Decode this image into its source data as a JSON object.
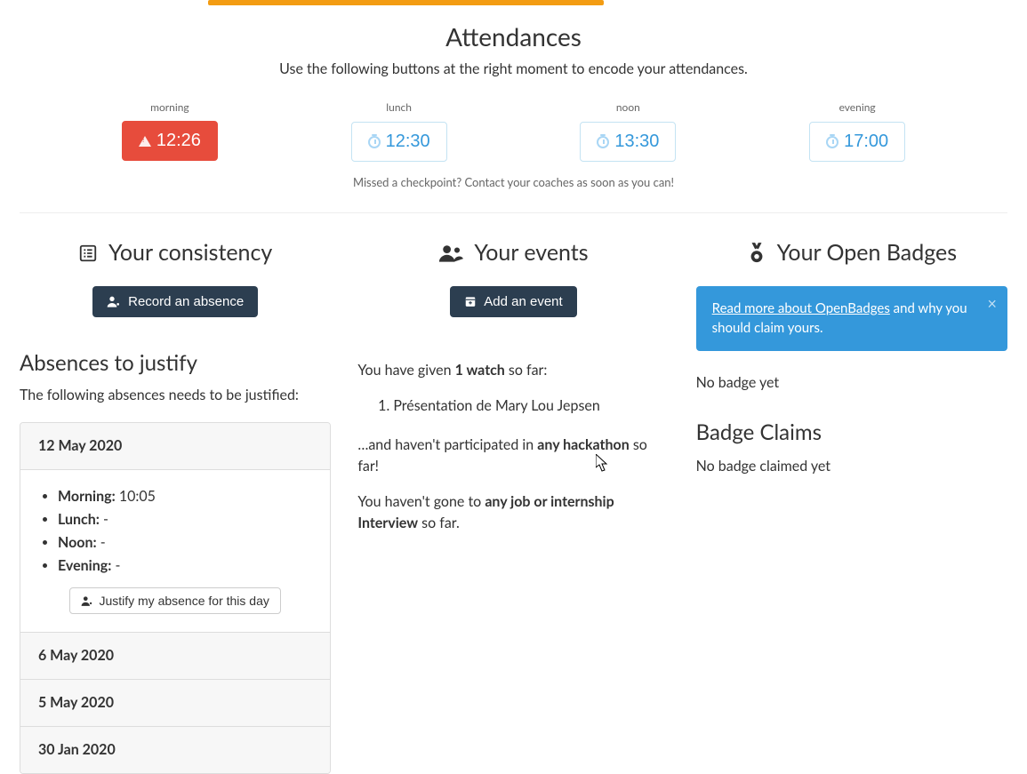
{
  "header": {
    "title": "Attendances",
    "subtitle": "Use the following buttons at the right moment to encode your attendances.",
    "missed_note": "Missed a checkpoint? Contact your coaches as soon as you can!"
  },
  "checkpoints": [
    {
      "label": "morning",
      "time": "12:26",
      "variant": "red",
      "icon": "warning-triangle-icon"
    },
    {
      "label": "lunch",
      "time": "12:30",
      "variant": "blue-outline",
      "icon": "stopwatch-icon"
    },
    {
      "label": "noon",
      "time": "13:30",
      "variant": "blue-outline",
      "icon": "stopwatch-icon"
    },
    {
      "label": "evening",
      "time": "17:00",
      "variant": "blue-outline",
      "icon": "stopwatch-icon"
    }
  ],
  "consistency": {
    "title": "Your consistency",
    "record_button": "Record an absence",
    "justify_title": "Absences to justify",
    "justify_desc": "The following absences needs to be justified:",
    "expanded": {
      "date": "12 May 2020",
      "rows": [
        {
          "label": "Morning:",
          "value": "10:05"
        },
        {
          "label": "Lunch:",
          "value": "-"
        },
        {
          "label": "Noon:",
          "value": "-"
        },
        {
          "label": "Evening:",
          "value": "-"
        }
      ],
      "justify_button": "Justify my absence for this day"
    },
    "collapsed": [
      "6 May 2020",
      "5 May 2020",
      "30 Jan 2020"
    ]
  },
  "events": {
    "title": "Your events",
    "add_button": "Add an event",
    "given_prefix": "You have given ",
    "given_bold": "1 watch",
    "given_suffix": " so far:",
    "watch_list": [
      "Présentation de Mary Lou Jepsen"
    ],
    "hack_prefix": "…and haven't participated in ",
    "hack_bold": "any hackathon",
    "hack_suffix": " so far!",
    "interview_prefix": "You haven't gone to ",
    "interview_bold": "any job or internship Interview",
    "interview_suffix": " so far."
  },
  "badges": {
    "title": "Your Open Badges",
    "alert_link": "Read more about OpenBadges",
    "alert_rest": " and why you should claim yours.",
    "no_badge": "No badge yet",
    "claims_title": "Badge Claims",
    "no_claim": "No badge claimed yet"
  }
}
